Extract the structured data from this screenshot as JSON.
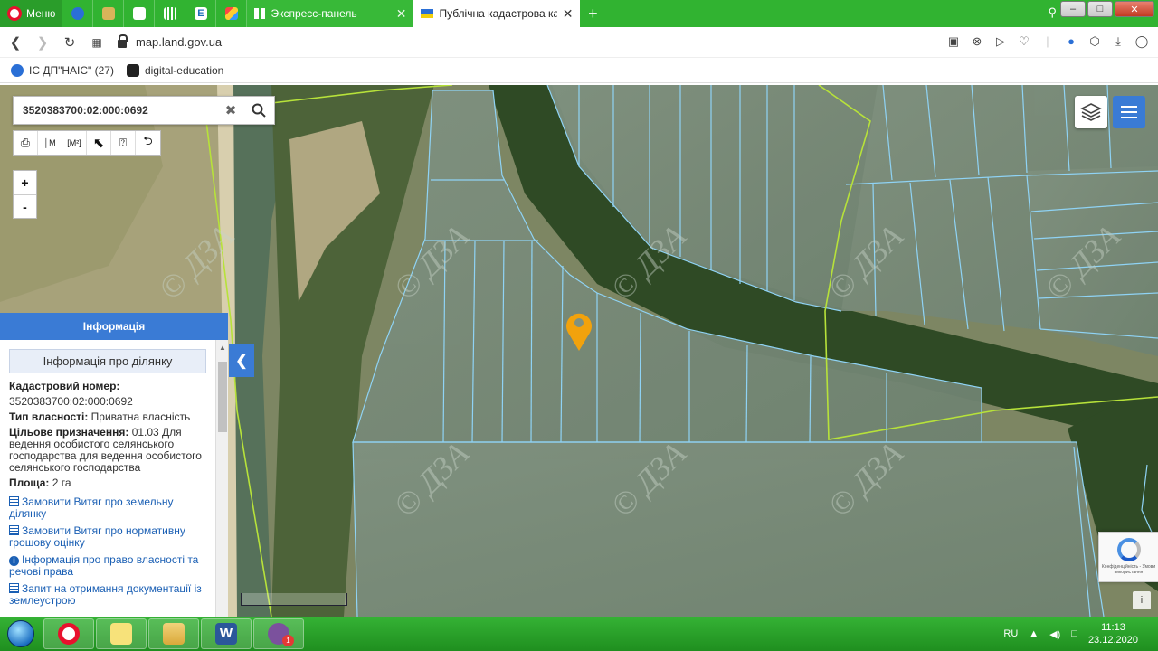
{
  "browser": {
    "menu_label": "Меню",
    "tabs": [
      {
        "label": "Экспресс-панель",
        "active": false
      },
      {
        "label": "Публічна кадастрова карт",
        "active": true
      }
    ],
    "url": "map.land.gov.ua",
    "bookmarks": [
      {
        "label": "ІС ДП\"НАІС\" (27)",
        "icon": "nais-icon"
      },
      {
        "label": "digital-education",
        "icon": "diia-icon"
      }
    ]
  },
  "map": {
    "search_value": "3520383700:02:000:0692",
    "tools": [
      "print-icon",
      "measure-length-icon",
      "measure-area-icon",
      "select-cursor-icon",
      "info-query-icon",
      "route-icon"
    ],
    "zoom_in": "+",
    "zoom_out": "-",
    "watermark": "© ДЗА",
    "marker_color": "#f2a20c",
    "parcel_outline_color": "#8fd3f5",
    "boundary_line_color": "#b7e23a"
  },
  "info_panel": {
    "header": "Інформація",
    "section_title": "Інформація про ділянку",
    "cadastral_label": "Кадастровий номер:",
    "cadastral_value": "3520383700:02:000:0692",
    "ownership_label": "Тип власності:",
    "ownership_value": "Приватна власність",
    "purpose_label": "Цільове призначення:",
    "purpose_value": "01.03 Для ведення особистого селянського господарства для ведення особистого селянського господарства",
    "area_label": "Площа:",
    "area_value": "2 га",
    "links": [
      {
        "icon": "document-icon",
        "label": "Замовити Витяг про земельну ділянку"
      },
      {
        "icon": "document-icon",
        "label": "Замовити Витяг про нормативну грошову оцінку"
      },
      {
        "icon": "info-icon",
        "label": "Інформація про право власності та речові права"
      },
      {
        "icon": "document-icon",
        "label": "Запит на отримання документації із землеустрою"
      }
    ]
  },
  "recaptcha": {
    "text": "Конфіденційність - Умови використання"
  },
  "taskbar": {
    "language": "RU",
    "time": "11:13",
    "date": "23.12.2020",
    "viber_badge": "1"
  }
}
